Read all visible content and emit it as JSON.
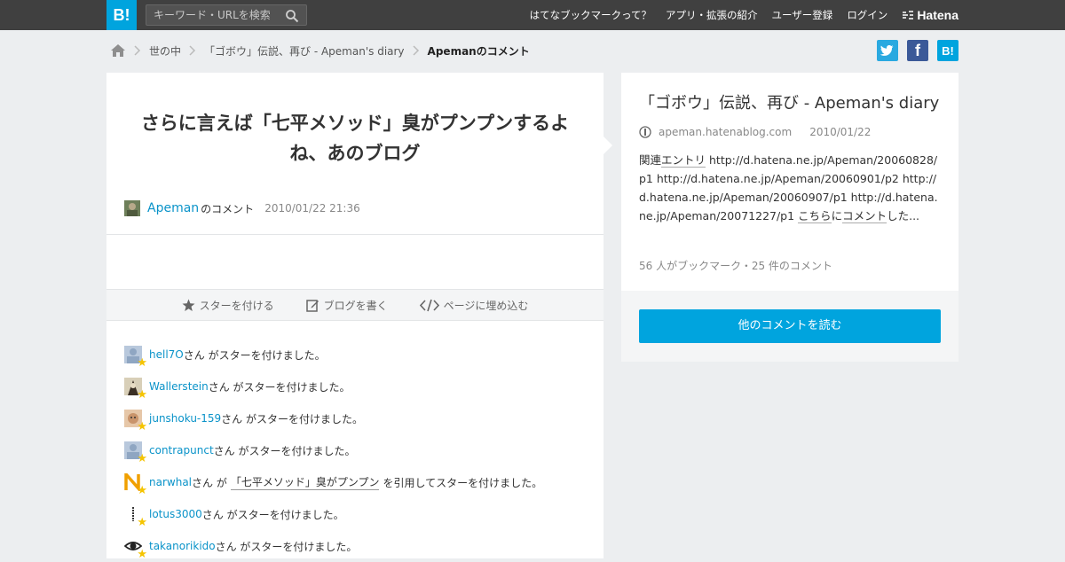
{
  "header": {
    "logo": "B!",
    "search_placeholder": "キーワード・URLを検索",
    "nav": [
      "はてなブックマークって？",
      "アプリ・拡張の紹介",
      "ユーザー登録",
      "ログイン"
    ],
    "brand": "Hatena"
  },
  "breadcrumb": {
    "items": [
      "世の中",
      "「ゴボウ」伝説、再び - Apeman's diary"
    ],
    "current": "Apemanのコメント"
  },
  "share": {
    "twitter": "t",
    "facebook": "f",
    "hatena": "B!"
  },
  "comment": {
    "title": "さらに言えば「七平メソッド」臭がプンプンするよね、あのブログ",
    "user": "Apeman",
    "no_comment": "のコメント",
    "datetime": "2010/01/22 21:36"
  },
  "actions": {
    "star": "スターを付ける",
    "blog": "ブログを書く",
    "embed": "ページに埋め込む"
  },
  "stars": [
    {
      "user": "hell7O",
      "text": "さん がスターを付けました。",
      "quote": "",
      "suffix": ""
    },
    {
      "user": "Wallerstein",
      "text": "さん がスターを付けました。",
      "quote": "",
      "suffix": ""
    },
    {
      "user": "junshoku-159",
      "text": "さん がスターを付けました。",
      "quote": "",
      "suffix": ""
    },
    {
      "user": "contrapunct",
      "text": "さん がスターを付けました。",
      "quote": "",
      "suffix": ""
    },
    {
      "user": "narwhal",
      "text": "さん が",
      "quote": "「七平メソッド」臭がプンプン",
      "suffix": "を引用してスターを付けました。"
    },
    {
      "user": "lotus3000",
      "text": "さん がスターを付けました。",
      "quote": "",
      "suffix": ""
    },
    {
      "user": "takanorikido",
      "text": "さん がスターを付けました。",
      "quote": "",
      "suffix": ""
    }
  ],
  "entry": {
    "title": "「ゴボウ」伝説、再び - Apeman's diary",
    "site": "apeman.hatenablog.com",
    "date": "2010/01/22",
    "body_pre": "関連",
    "body_kw1": "エントリ",
    "body_mid": " http://d.hatena.ne.jp/Apeman/20060828/p1 http://d.hatena.ne.jp/Apeman/20060901/p2 http://d.hatena.ne.jp/Apeman/20060907/p1 http://d.hatena.ne.jp/Apeman/20071227/p1 ",
    "body_kw2": "こちら",
    "body_mid2": "に",
    "body_kw3": "コメント",
    "body_post": "した...",
    "stats": "56 人がブックマーク・25 件のコメント",
    "read_more": "他のコメントを読む"
  },
  "colors": {
    "accent": "#00a4de",
    "topbar": "#404040",
    "link": "#0a93c9",
    "star": "#f5c400"
  }
}
